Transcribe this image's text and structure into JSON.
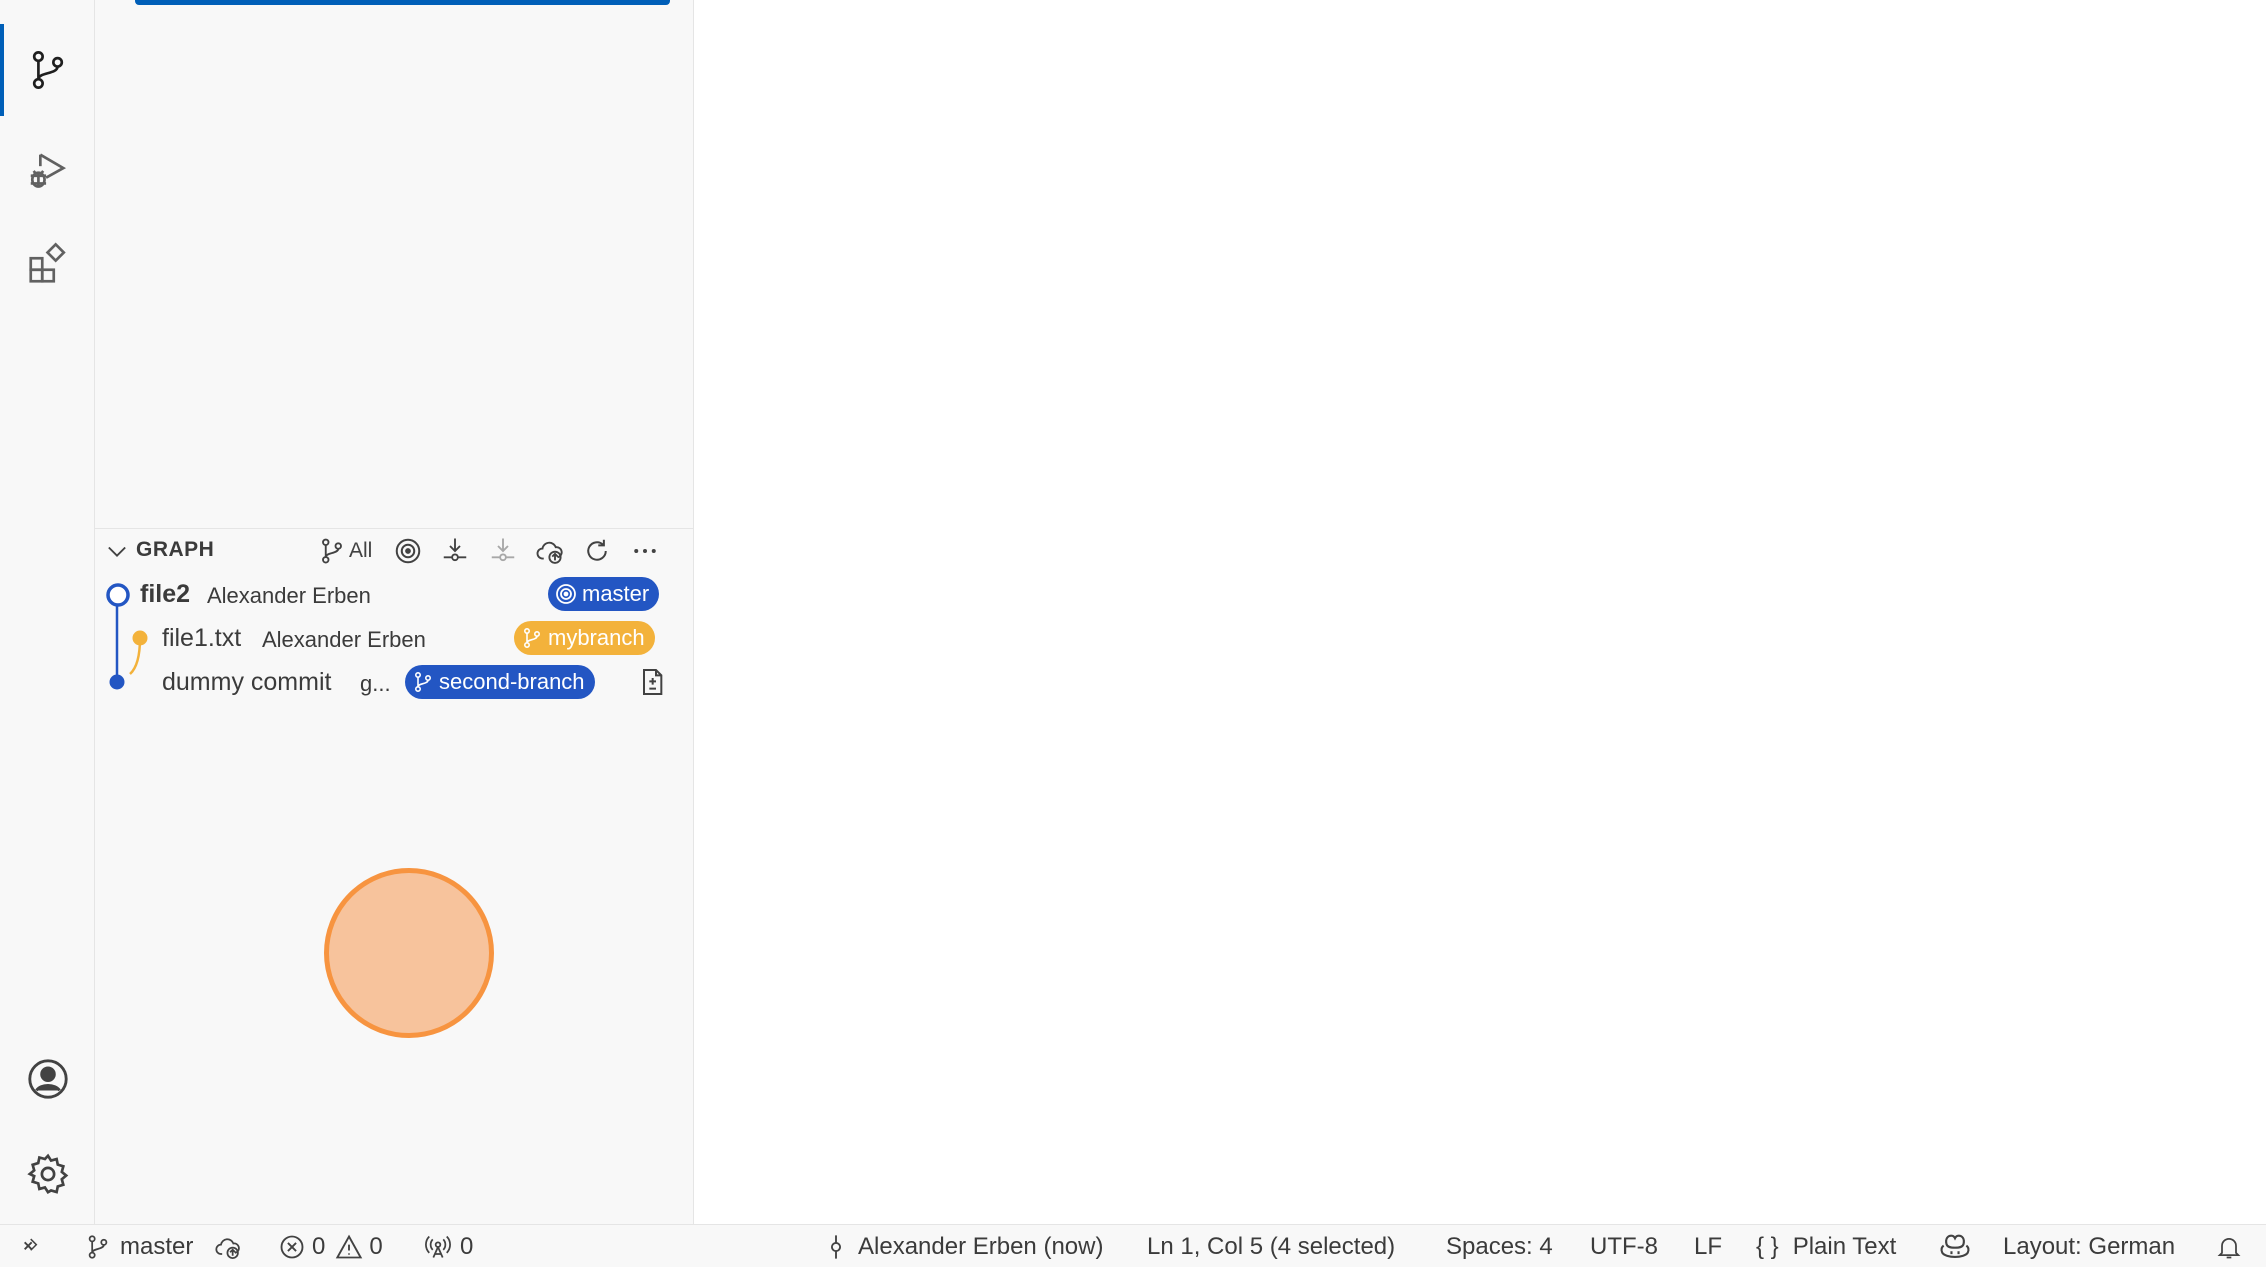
{
  "graph": {
    "title": "GRAPH",
    "branches_filter": "All"
  },
  "commits": [
    {
      "message": "file2",
      "author": "Alexander Erben",
      "badge": "master"
    },
    {
      "message": "file1.txt",
      "author": "Alexander Erben",
      "badge": "mybranch"
    },
    {
      "message": "dummy commit",
      "author": "g...",
      "badge": "second-branch"
    }
  ],
  "status": {
    "branch": "master",
    "errors": "0",
    "warnings": "0",
    "ports": "0",
    "blame": "Alexander Erben (now)",
    "cursor": "Ln 1, Col 5 (4 selected)",
    "indent": "Spaces: 4",
    "encoding": "UTF-8",
    "eol": "LF",
    "language_icon": "{ }",
    "language": "Plain Text",
    "layout": "Layout: German"
  },
  "colors": {
    "accent": "#005fb8",
    "branch_blue": "#2356c3",
    "branch_yellow": "#f3b23b",
    "touch": "#f79440"
  },
  "icons": [
    "source-control-icon",
    "run-debug-icon",
    "extensions-icon",
    "account-icon",
    "settings-gear-icon"
  ]
}
